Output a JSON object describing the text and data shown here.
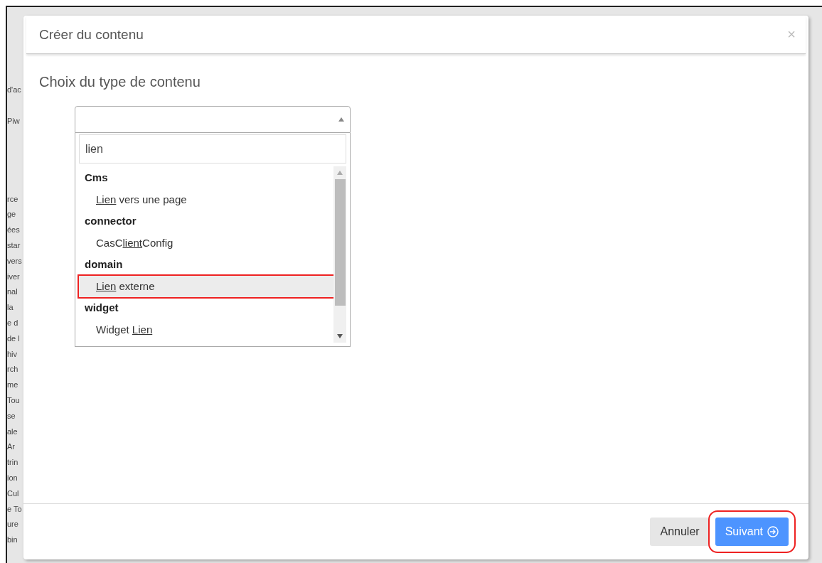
{
  "background_fragments": [
    "d'ac",
    "Piw",
    "rce",
    "ge",
    "ées",
    "star",
    "vers",
    "iver",
    "nal",
    "la",
    "e d",
    "de l",
    "hiv",
    "rch",
    "me",
    "Tou",
    "se",
    "ale",
    "Ar",
    "trin",
    "ion",
    "Cul",
    "e To",
    "ure",
    "bin"
  ],
  "dialog": {
    "title": "Créer du contenu",
    "close": "×",
    "section_title": "Choix du type de contenu",
    "select": {
      "expanded": true,
      "search_value": "lien",
      "groups": [
        {
          "label": "Cms",
          "options": [
            {
              "parts": [
                {
                  "text": "Lien",
                  "match": true
                },
                {
                  "text": " vers une page",
                  "match": false
                }
              ],
              "selected": false,
              "highlighted": false
            }
          ]
        },
        {
          "label": "connector",
          "options": [
            {
              "parts": [
                {
                  "text": "CasC",
                  "match": false
                },
                {
                  "text": "lient",
                  "match": true
                },
                {
                  "text": "Config",
                  "match": false
                }
              ],
              "selected": false,
              "highlighted": false
            }
          ]
        },
        {
          "label": "domain",
          "options": [
            {
              "parts": [
                {
                  "text": "Lien",
                  "match": true
                },
                {
                  "text": " externe",
                  "match": false
                }
              ],
              "selected": true,
              "highlighted": true
            }
          ]
        },
        {
          "label": "widget",
          "options": [
            {
              "parts": [
                {
                  "text": "Widget ",
                  "match": false
                },
                {
                  "text": "Lien",
                  "match": true
                }
              ],
              "selected": false,
              "highlighted": false
            }
          ]
        }
      ]
    },
    "buttons": [
      {
        "label": "Annuler",
        "kind": "secondary",
        "highlighted": false
      },
      {
        "label": "Suivant",
        "kind": "primary",
        "highlighted": true
      }
    ]
  }
}
